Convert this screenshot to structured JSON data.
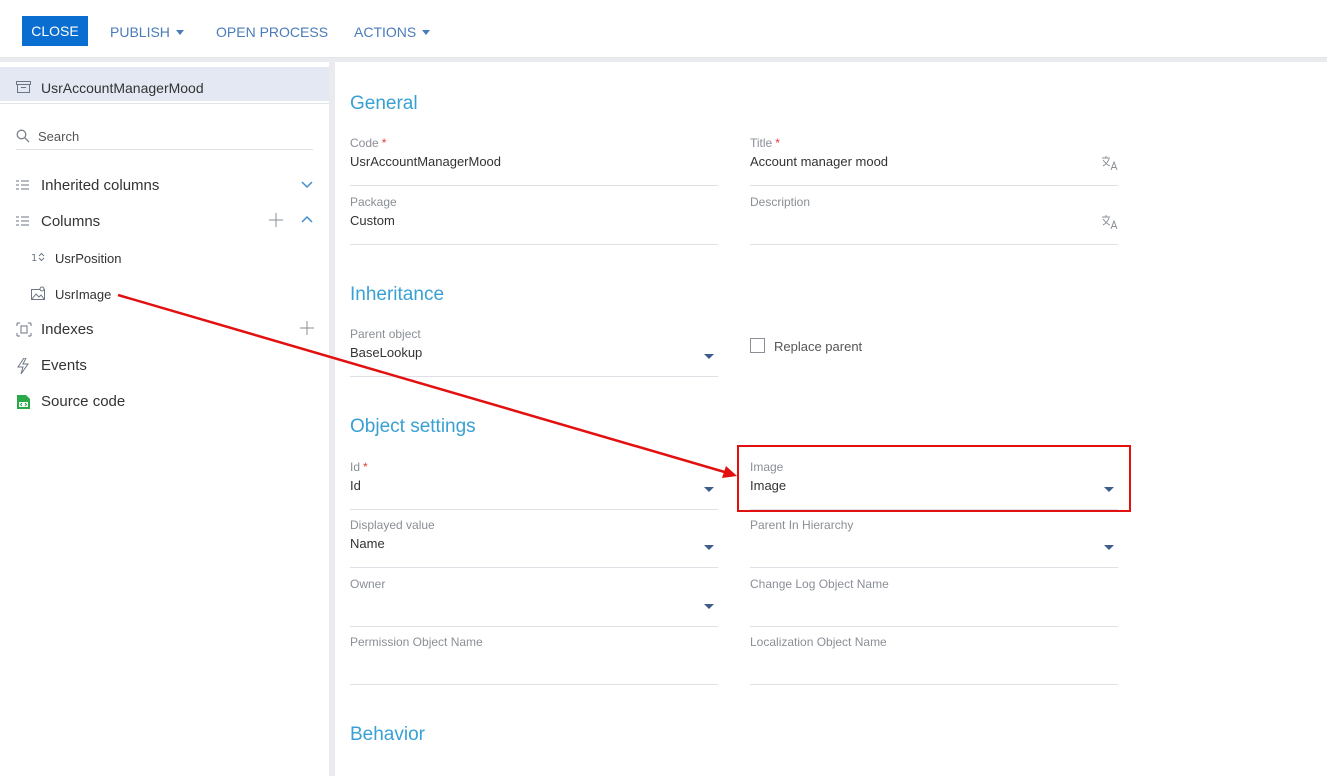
{
  "toolbar": {
    "close_label": "CLOSE",
    "publish_label": "PUBLISH",
    "open_process_label": "OPEN PROCESS",
    "actions_label": "ACTIONS"
  },
  "sidebar": {
    "object_name": "UsrAccountManagerMood",
    "search_placeholder": "Search",
    "items": [
      {
        "label": "Inherited columns",
        "icon": "columns-icon"
      },
      {
        "label": "Columns",
        "icon": "columns-icon"
      },
      {
        "label": "UsrPosition",
        "icon": "number-icon"
      },
      {
        "label": "UsrImage",
        "icon": "image-icon"
      },
      {
        "label": "Indexes",
        "icon": "index-icon"
      },
      {
        "label": "Events",
        "icon": "lightning-icon"
      },
      {
        "label": "Source code",
        "icon": "source-code-icon"
      }
    ]
  },
  "main": {
    "sections": {
      "general": "General",
      "inheritance": "Inheritance",
      "object_settings": "Object settings",
      "behavior": "Behavior"
    },
    "fields": {
      "code": {
        "label": "Code",
        "value": "UsrAccountManagerMood"
      },
      "title": {
        "label": "Title",
        "value": "Account manager mood"
      },
      "package": {
        "label": "Package",
        "value": "Custom"
      },
      "description": {
        "label": "Description",
        "value": ""
      },
      "parent_object": {
        "label": "Parent object",
        "value": "BaseLookup"
      },
      "replace_parent": {
        "label": "Replace parent",
        "checked": false
      },
      "id": {
        "label": "Id",
        "value": "Id"
      },
      "image": {
        "label": "Image",
        "value": "Image"
      },
      "displayed_value": {
        "label": "Displayed value",
        "value": "Name"
      },
      "parent_in_hierarchy": {
        "label": "Parent In Hierarchy",
        "value": ""
      },
      "owner": {
        "label": "Owner",
        "value": ""
      },
      "change_log_object_name": {
        "label": "Change Log Object Name",
        "value": ""
      },
      "permission_object_name": {
        "label": "Permission Object Name",
        "value": ""
      },
      "localization_object_name": {
        "label": "Localization Object Name",
        "value": ""
      }
    },
    "required_marker": "*"
  },
  "colors": {
    "accent": "#0a6ed1",
    "section_title": "#39a0d4",
    "annotation": "#e31010",
    "selected_row": "#e3e8f3"
  }
}
